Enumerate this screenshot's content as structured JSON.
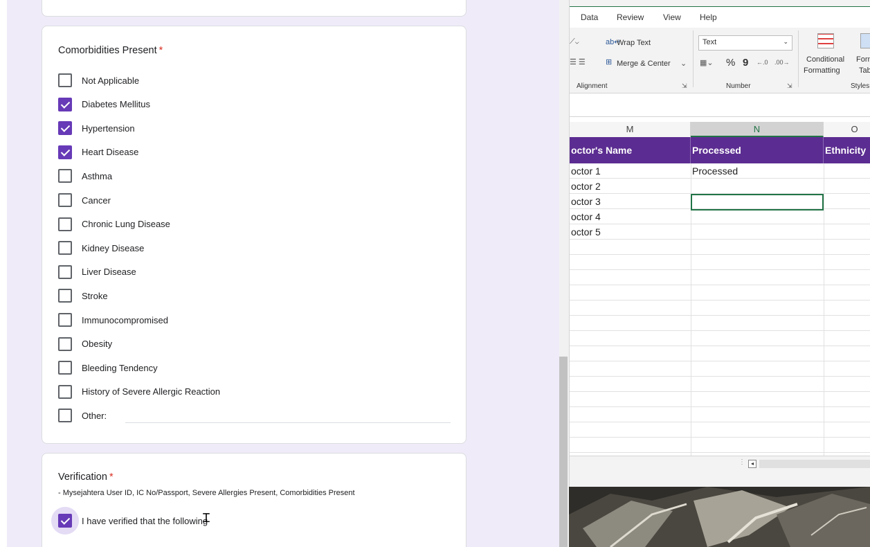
{
  "form": {
    "comorbidities": {
      "title": "Comorbidities Present",
      "required_mark": "*",
      "options": [
        {
          "label": "Not Applicable",
          "checked": false
        },
        {
          "label": "Diabetes Mellitus",
          "checked": true
        },
        {
          "label": "Hypertension",
          "checked": true
        },
        {
          "label": "Heart Disease",
          "checked": true
        },
        {
          "label": "Asthma",
          "checked": false
        },
        {
          "label": "Cancer",
          "checked": false
        },
        {
          "label": "Chronic Lung Disease",
          "checked": false
        },
        {
          "label": "Kidney Disease",
          "checked": false
        },
        {
          "label": "Liver Disease",
          "checked": false
        },
        {
          "label": "Stroke",
          "checked": false
        },
        {
          "label": "Immunocompromised",
          "checked": false
        },
        {
          "label": "Obesity",
          "checked": false
        },
        {
          "label": "Bleeding Tendency",
          "checked": false
        },
        {
          "label": "History of Severe Allergic Reaction",
          "checked": false
        },
        {
          "label": "Other:",
          "checked": false
        }
      ]
    },
    "verification": {
      "title": "Verification",
      "required_mark": "*",
      "description": "- Mysejahtera User ID, IC No/Passport, Severe Allergies Present, Comorbidities Present",
      "checkbox_label": "I have verified that the following",
      "checked": true
    }
  },
  "excel": {
    "menu_tabs": [
      "Data",
      "Review",
      "View",
      "Help"
    ],
    "ribbon": {
      "wrap_text": "Wrap Text",
      "merge_center": "Merge & Center",
      "alignment_group": "Alignment",
      "number_format": "Text",
      "percent": "%",
      "comma": "9",
      "number_group": "Number",
      "conditional_formatting_line1": "Conditional",
      "conditional_formatting_line2": "Formatting",
      "format_table_line1": "Form",
      "format_table_line2": "Tab",
      "styles_group": "Styles"
    },
    "columns": [
      "M",
      "N",
      "O"
    ],
    "selected_column": "N",
    "headers": [
      "octor's Name",
      "Processed",
      "Ethnicity"
    ],
    "header_color": "#5b2c91",
    "rows": [
      [
        "octor 1",
        "Processed",
        ""
      ],
      [
        "octor 2",
        "",
        ""
      ],
      [
        "octor 3",
        "",
        ""
      ],
      [
        "octor 4",
        "",
        ""
      ],
      [
        "octor 5",
        "",
        ""
      ]
    ],
    "accent": "#217346"
  }
}
